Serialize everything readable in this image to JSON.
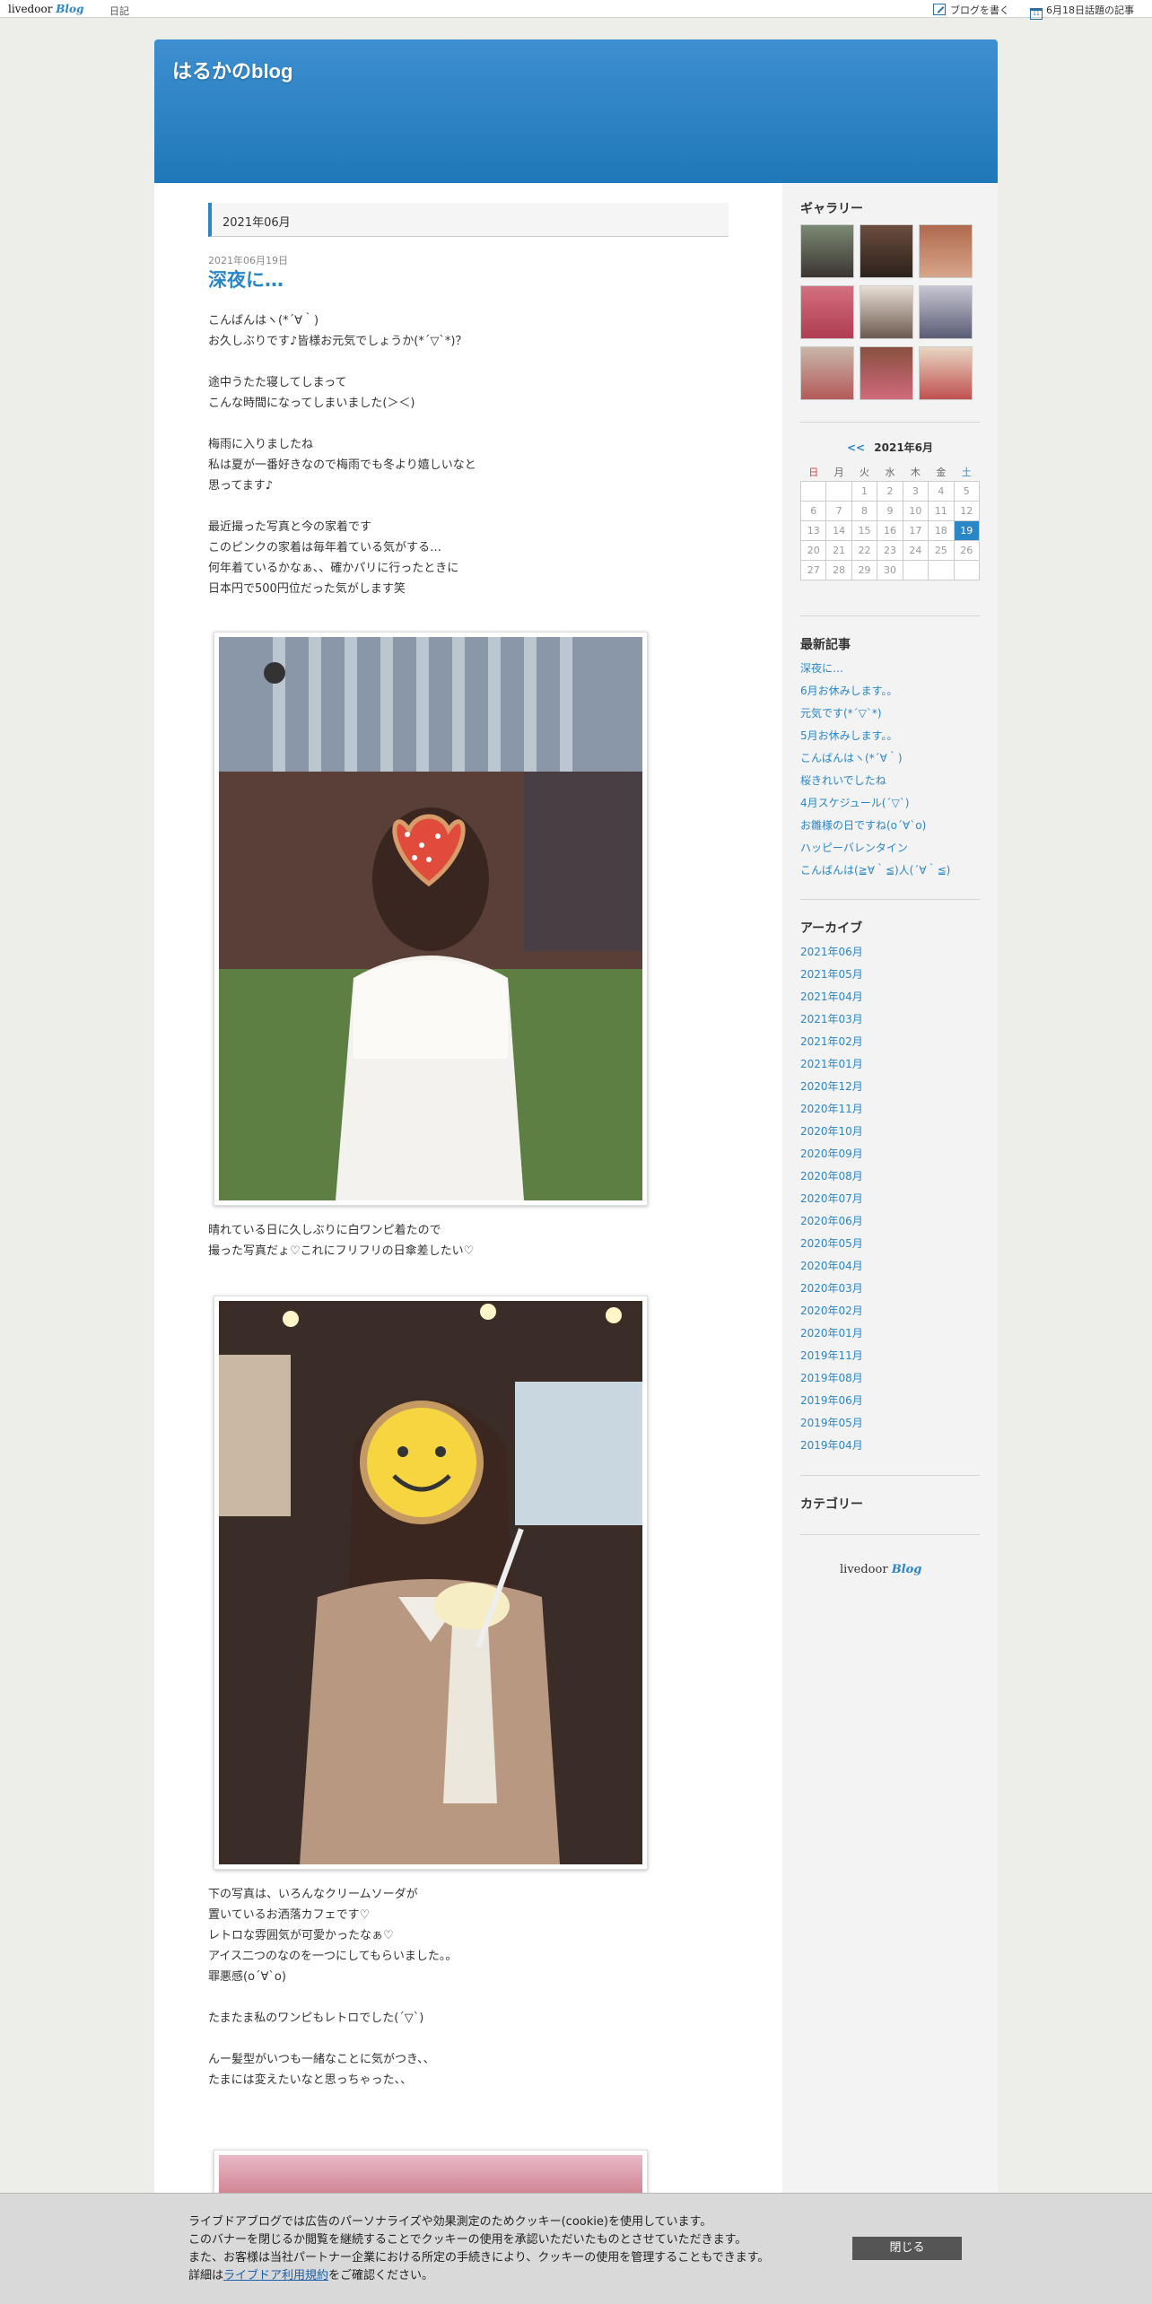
{
  "topbar": {
    "logo_main": "livedoor",
    "logo_blog": "Blog",
    "diary": "日記",
    "write_blog": "ブログを書く",
    "trending": "6月18日話題の記事",
    "calendar_icon_day": "11"
  },
  "header": {
    "title": "はるかのblog"
  },
  "main": {
    "month_heading": "2021年06月",
    "post": {
      "date": "2021年06月19日",
      "title": "深夜に…",
      "paragraph1": [
        "こんばんはヽ(*´∀｀)",
        "お久しぶりです♪皆様お元気でしょうか(*´▽`*)？",
        "",
        "途中うたた寝してしまって",
        "こんな時間になってしまいました(＞＜)",
        "",
        "梅雨に入りましたね",
        "私は夏が一番好きなので梅雨でも冬より嬉しいなと",
        "思ってます♪",
        "",
        "最近撮った写真と今の家着です",
        "このピンクの家着は毎年着ている気がする…",
        "何年着ているかなぁ、、確かパリに行ったときに",
        "日本円で500円位だった気がします笑"
      ],
      "paragraph2": [
        "晴れている日に久しぶりに白ワンピ着たので",
        "撮った写真だょ♡これにフリフリの日傘差したい♡"
      ],
      "paragraph3": [
        "下の写真は、いろんなクリームソーダが",
        "置いているお洒落カフェです♡",
        "レトロな雰囲気が可愛かったなぁ♡",
        "アイス二つのなのを一つにしてもらいました。。",
        "罪悪感(o´∀`o)",
        "",
        "たまたま私のワンピもレトロでした(´▽`)",
        "",
        "んー髪型がいつも一緒なことに気がつき、、",
        "たまには変えたいなと思っちゃった、、"
      ]
    }
  },
  "side": {
    "gallery_title": "ギャラリー",
    "calendar": {
      "prev": "<<",
      "month": "2021年6月",
      "weekdays": [
        "日",
        "月",
        "火",
        "水",
        "木",
        "金",
        "土"
      ],
      "rows": [
        [
          "",
          "",
          "1",
          "2",
          "3",
          "4",
          "5"
        ],
        [
          "6",
          "7",
          "8",
          "9",
          "10",
          "11",
          "12"
        ],
        [
          "13",
          "14",
          "15",
          "16",
          "17",
          "18",
          "19"
        ],
        [
          "20",
          "21",
          "22",
          "23",
          "24",
          "25",
          "26"
        ],
        [
          "27",
          "28",
          "29",
          "30",
          "",
          "",
          ""
        ]
      ],
      "today": "19"
    },
    "recent_title": "最新記事",
    "recent": [
      "深夜に…",
      "6月お休みします。。",
      "元気です(*´▽`*)",
      "5月お休みします。。",
      "こんばんはヽ(*´∀｀)",
      "桜きれいでしたね",
      "4月スケジュール(´▽`)",
      "お雛様の日ですね(o´∀`o)",
      "ハッピーバレンタイン",
      "こんばんは(≧∀｀≦)人(´∀｀≦)"
    ],
    "archive_title": "アーカイブ",
    "archives": [
      "2021年06月",
      "2021年05月",
      "2021年04月",
      "2021年03月",
      "2021年02月",
      "2021年01月",
      "2020年12月",
      "2020年11月",
      "2020年10月",
      "2020年09月",
      "2020年08月",
      "2020年07月",
      "2020年06月",
      "2020年05月",
      "2020年04月",
      "2020年03月",
      "2020年02月",
      "2020年01月",
      "2019年11月",
      "2019年08月",
      "2019年06月",
      "2019年05月",
      "2019年04月"
    ],
    "category_title": "カテゴリー",
    "logo_main": "livedoor",
    "logo_blog": "Blog"
  },
  "cookie": {
    "line1": "ライブドアブログでは広告のパーソナライズや効果測定のためクッキー(cookie)を使用しています。",
    "line2": "このバナーを閉じるか閲覧を継続することでクッキーの使用を承認いただいたものとさせていただきます。",
    "line3": "また、お客様は当社パートナー企業における所定の手続きにより、クッキーの使用を管理することもできます。",
    "line4_prefix": "詳細は",
    "line4_link": "ライブドア利用規約",
    "line4_suffix": "をご確認ください。",
    "close_label": "閉じる"
  },
  "colors": {
    "accent": "#2a86c6",
    "header_top": "#3d8fd0",
    "header_bottom": "#1f78b9",
    "sunday": "#d24040"
  }
}
